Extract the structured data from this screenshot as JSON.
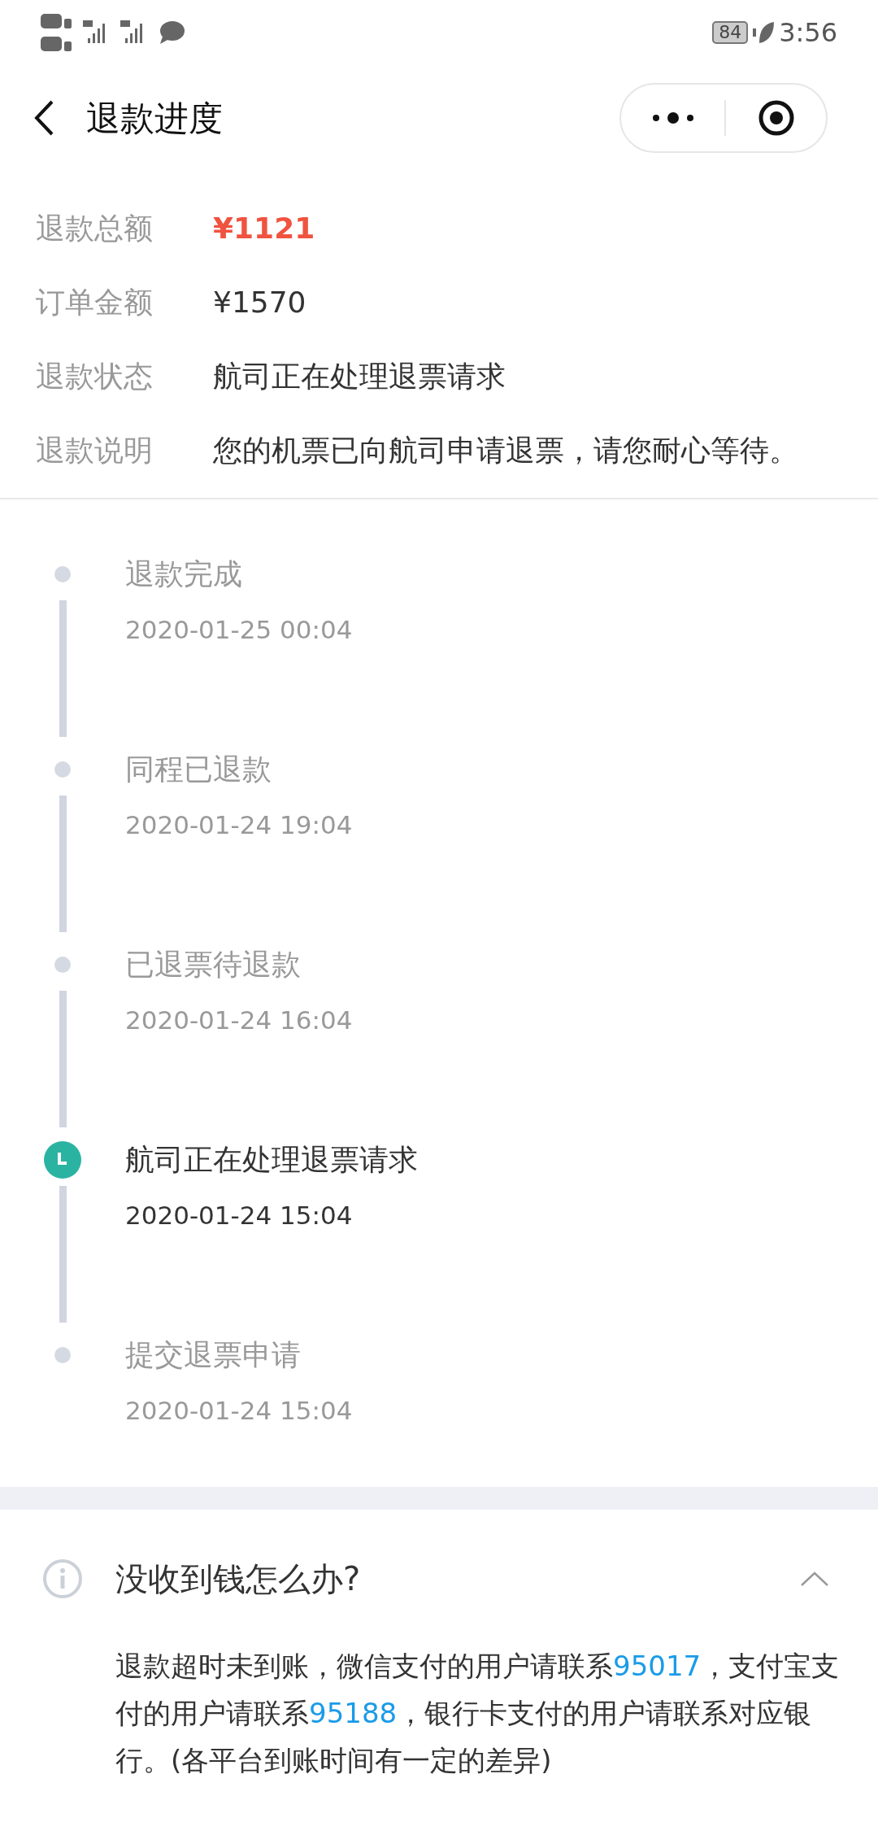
{
  "status_bar": {
    "battery": "84",
    "time": "3:56"
  },
  "header": {
    "title": "退款进度"
  },
  "summary": [
    {
      "label": "退款总额",
      "value": "¥1121",
      "kind": "amount"
    },
    {
      "label": "订单金额",
      "value": "¥1570",
      "kind": "plain"
    },
    {
      "label": "退款状态",
      "value": "航司正在处理退票请求",
      "kind": "plain"
    },
    {
      "label": "退款说明",
      "value": "您的机票已向航司申请退票，请您耐心等待。",
      "kind": "plain"
    }
  ],
  "timeline": [
    {
      "title": "退款完成",
      "time": "2020-01-25 00:04",
      "current": false
    },
    {
      "title": "同程已退款",
      "time": "2020-01-24 19:04",
      "current": false
    },
    {
      "title": "已退票待退款",
      "time": "2020-01-24 16:04",
      "current": false
    },
    {
      "title": "航司正在处理退票请求",
      "time": "2020-01-24 15:04",
      "current": true
    },
    {
      "title": "提交退票申请",
      "time": "2020-01-24 15:04",
      "current": false
    }
  ],
  "faq": {
    "title": "没收到钱怎么办?",
    "expanded": true,
    "body": [
      {
        "kind": "text",
        "text": "退款超时未到账，微信支付的用户请联系"
      },
      {
        "kind": "phone",
        "text": "95017"
      },
      {
        "kind": "text",
        "text": "，支付宝支付的用户请联系"
      },
      {
        "kind": "phone",
        "text": "95188"
      },
      {
        "kind": "text",
        "text": "，银行卡支付的用户请联系对应银行。(各平台到账时间有一定的差异)"
      }
    ]
  }
}
